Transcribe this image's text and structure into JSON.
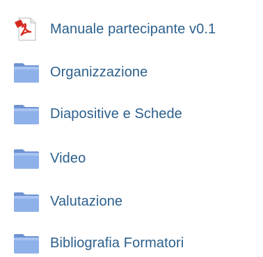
{
  "files": [
    {
      "label": "Manuale partecipante v0.1",
      "icon": "pdf-icon"
    },
    {
      "label": "Organizzazione",
      "icon": "folder-icon"
    },
    {
      "label": "Diapositive e Schede",
      "icon": "folder-icon"
    },
    {
      "label": "Video",
      "icon": "folder-icon"
    },
    {
      "label": "Valutazione",
      "icon": "folder-icon"
    },
    {
      "label": "Bibliografia Formatori",
      "icon": "folder-icon"
    }
  ],
  "colors": {
    "link": "#2b5f8c",
    "folder": "#7fa3e0",
    "pdf_red": "#d42a1e"
  }
}
